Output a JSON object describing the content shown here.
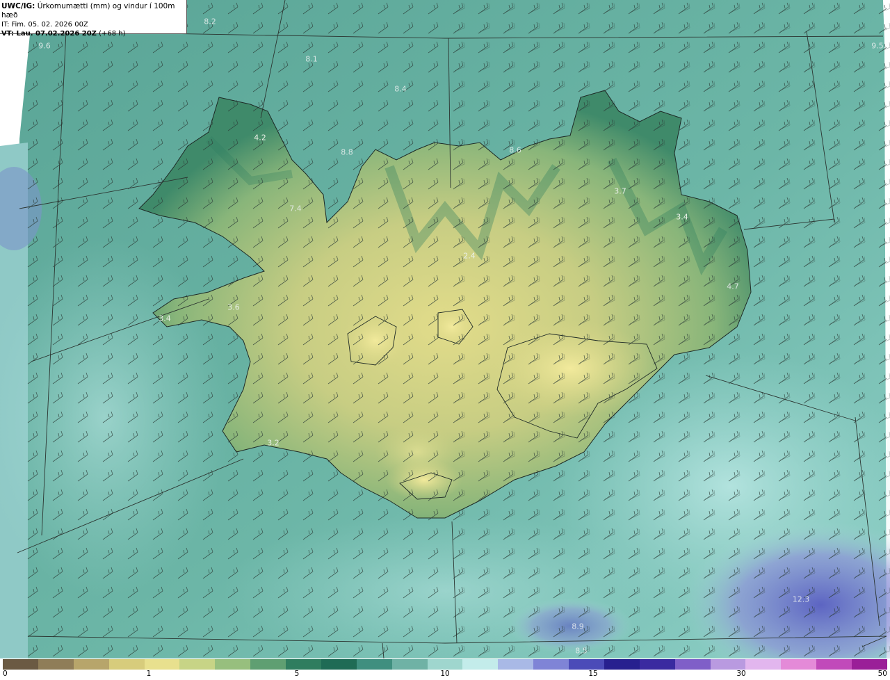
{
  "title": {
    "model": "UWC/IG:",
    "description": "Úrkomumætti (mm) og vindur í 100m hæð",
    "it_label": "IT: Fim. 05. 02. 2026 00Z",
    "vt_bold": "VT: Lau. 07.02.2026 20Z",
    "vt_rest": "(+68 h)"
  },
  "colors": {
    "sea_base": "#5fae9f",
    "land_high": "#e0dc88",
    "land_mid": "#7fb07a",
    "ocean_light": "#a8dad6",
    "ocean_purple": "#6f72c4"
  },
  "precip_labels": [
    {
      "text": "8.2"
    },
    {
      "text": "9.6"
    },
    {
      "text": "8.1"
    },
    {
      "text": "8.4"
    },
    {
      "text": "4.2"
    },
    {
      "text": "8.8"
    },
    {
      "text": "8.6"
    },
    {
      "text": "3.7"
    },
    {
      "text": "3.4"
    },
    {
      "text": "7.4"
    },
    {
      "text": "2.4"
    },
    {
      "text": "3.6"
    },
    {
      "text": "3.4"
    },
    {
      "text": "3.2"
    },
    {
      "text": "4.7"
    },
    {
      "text": "12.3"
    },
    {
      "text": "8.9"
    },
    {
      "text": "8.5"
    },
    {
      "text": "9.5"
    }
  ],
  "colorbar": {
    "ticks": [
      "0",
      "1",
      "5",
      "10",
      "15",
      "30",
      "50"
    ],
    "colors": [
      "#6b5a43",
      "#8f7d58",
      "#b7a56b",
      "#d7cc7c",
      "#e8e08e",
      "#c7d486",
      "#97bf7e",
      "#5f9f72",
      "#2f7d5f",
      "#1f6b55",
      "#3f8f7f",
      "#6fb2a5",
      "#9fd6ce",
      "#c3ecea",
      "#a9b9e6",
      "#7f84d6",
      "#4b4bb8",
      "#27208f",
      "#3a2aa0",
      "#7f5fc8",
      "#b99ae0",
      "#e2b6ee",
      "#e48ad8",
      "#c14aba",
      "#9a1f98"
    ]
  }
}
